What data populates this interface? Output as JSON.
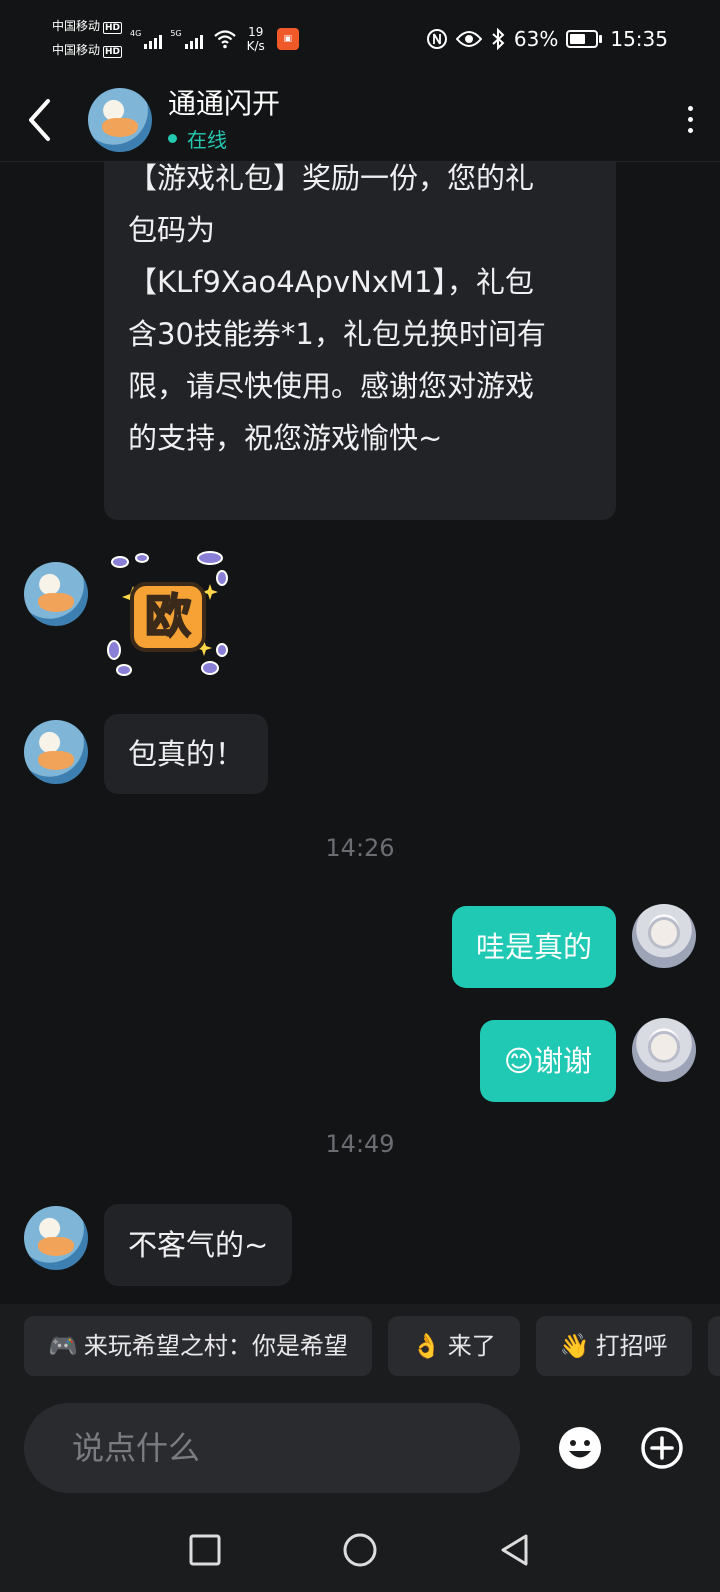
{
  "status_bar": {
    "carrier_1": "中国移动",
    "carrier_2": "中国移动",
    "hd": "HD",
    "net_1": "4G",
    "net_2": "5G",
    "speed_value": "19",
    "speed_unit": "K/s",
    "battery": "63%",
    "battery_level": 0.63,
    "time": "15:35"
  },
  "header": {
    "contact_name": "通通闪开",
    "status": "在线"
  },
  "messages": {
    "m1_lines": [
      "【游戏礼包】奖励一份，您的礼",
      "包码为",
      "【KLf9Xao4ApvNxM1】，礼包",
      "含30技能券*1，礼包兑换时间有",
      "限，请尽快使用。感谢您对游戏",
      "的支持，祝您游戏愉快~"
    ],
    "m2_sticker": "欧",
    "m3": "包真的！",
    "t1": "14:26",
    "m4": "哇是真的",
    "m5": "谢谢",
    "t2": "14:49",
    "m6": "不客气的~"
  },
  "quick_replies": [
    {
      "icon": "🎮",
      "label": "来玩希望之村：你是希望"
    },
    {
      "icon": "👌",
      "label": "来了"
    },
    {
      "icon": "👋",
      "label": "打招呼"
    }
  ],
  "input": {
    "placeholder": "说点什么"
  },
  "colors": {
    "accent": "#1fc9b4",
    "background": "#131415",
    "bubble": "#222327"
  }
}
